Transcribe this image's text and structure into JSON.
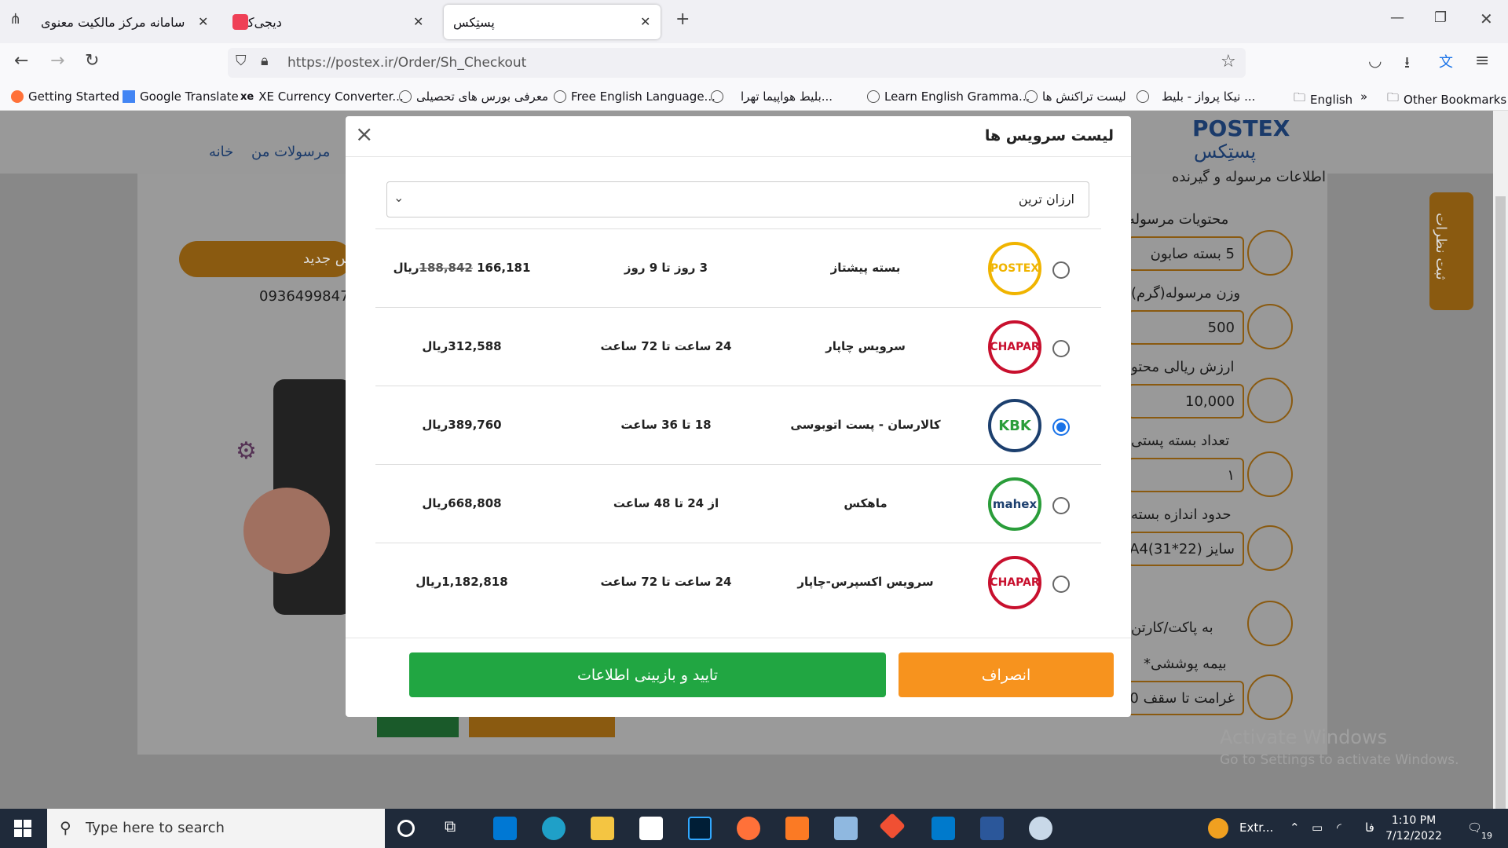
{
  "tabs": [
    {
      "label": "سامانه مرکز مالکیت معنوی"
    },
    {
      "label": "دیجی‌کالا"
    },
    {
      "label": "پستِکس"
    }
  ],
  "url": "https://postex.ir/Order/Sh_Checkout",
  "bookmarks": [
    "Getting Started",
    "Google Translate",
    "XE Currency Converter...",
    "معرفی بورس های تحصیلی",
    "Free English Language...",
    "بلیط هواپیما تهرا...",
    "Learn English Gramma...",
    "لیست تراکنش ها",
    "نیکا پرواز - بلیط ...",
    "English",
    "Other Bookmarks"
  ],
  "background_page": {
    "brand": "POSTEX",
    "brand_fa": "پستِکس",
    "nav_home": "خانه",
    "nav_parcels": "مرسولات من",
    "section_title": "اطلاعات مرسوله و گیرنده",
    "contents_label": "محتویات مرسوله",
    "contents_value": "5 بسته صابون",
    "weight_label": "وزن مرسوله(گرم)",
    "weight_value": "500",
    "value_label": "ارزش ریالی محتو",
    "value_value": "10,000",
    "count_label": "تعداد بسته پستی",
    "count_value": "١",
    "size_label": "حدود اندازه بسته",
    "size_value": "سایز A4(31*22)",
    "packing_label": "به پاکت/کارتن",
    "insurance_label": "بیمه پوششی*",
    "insurance_value": "غرامت تا سقف 00",
    "phone": "0936499847",
    "new_address": "س جدید",
    "feedback": "ثبت نظرات"
  },
  "modal": {
    "title": "لیست سرویس ها",
    "sort_value": "ارزان ترین",
    "services": [
      {
        "name": "بسته پیشتاز",
        "time": "3 روز تا 9 روز",
        "old_price": "188,842",
        "price": "166,181",
        "currency": "ریال",
        "selected": false,
        "logo": "postex-logo",
        "logo_color": "#f0b400"
      },
      {
        "name": "سرویس چاپار",
        "time": "24 ساعت تا 72 ساعت",
        "price": "312,588",
        "currency": "ریال",
        "selected": false,
        "logo": "chapar-logo",
        "logo_color": "#c8102e"
      },
      {
        "name": "کالارسان - پست اتوبوسی",
        "time": "18 تا 36 ساعت",
        "price": "389,760",
        "currency": "ریال",
        "selected": true,
        "logo": "kbk-logo",
        "logo_color": "#1c3f6e"
      },
      {
        "name": "ماهکس",
        "time": "از 24 تا 48 ساعت",
        "price": "668,808",
        "currency": "ریال",
        "selected": false,
        "logo": "mahex-logo",
        "logo_color": "#2a9d3a"
      },
      {
        "name": "سرویس اکسپرس-چاپار",
        "time": "24 ساعت تا 72 ساعت",
        "price": "1,182,818",
        "currency": "ریال",
        "selected": false,
        "logo": "chapar-logo",
        "logo_color": "#c8102e"
      }
    ],
    "cancel_label": "انصراف",
    "confirm_label": "تایید و بازبینی اطلاعات"
  },
  "watermark": {
    "line1": "Activate Windows",
    "line2": "Go to Settings to activate Windows."
  },
  "taskbar": {
    "search_placeholder": "Type here to search",
    "tray_text": "Extr...",
    "lang": "فا",
    "time": "1:10 PM",
    "date": "7/12/2022",
    "notif_count": "19"
  },
  "colors": {
    "accent_orange": "#f7931e",
    "confirm_green": "#21a642",
    "radio_blue": "#1a73e8"
  }
}
